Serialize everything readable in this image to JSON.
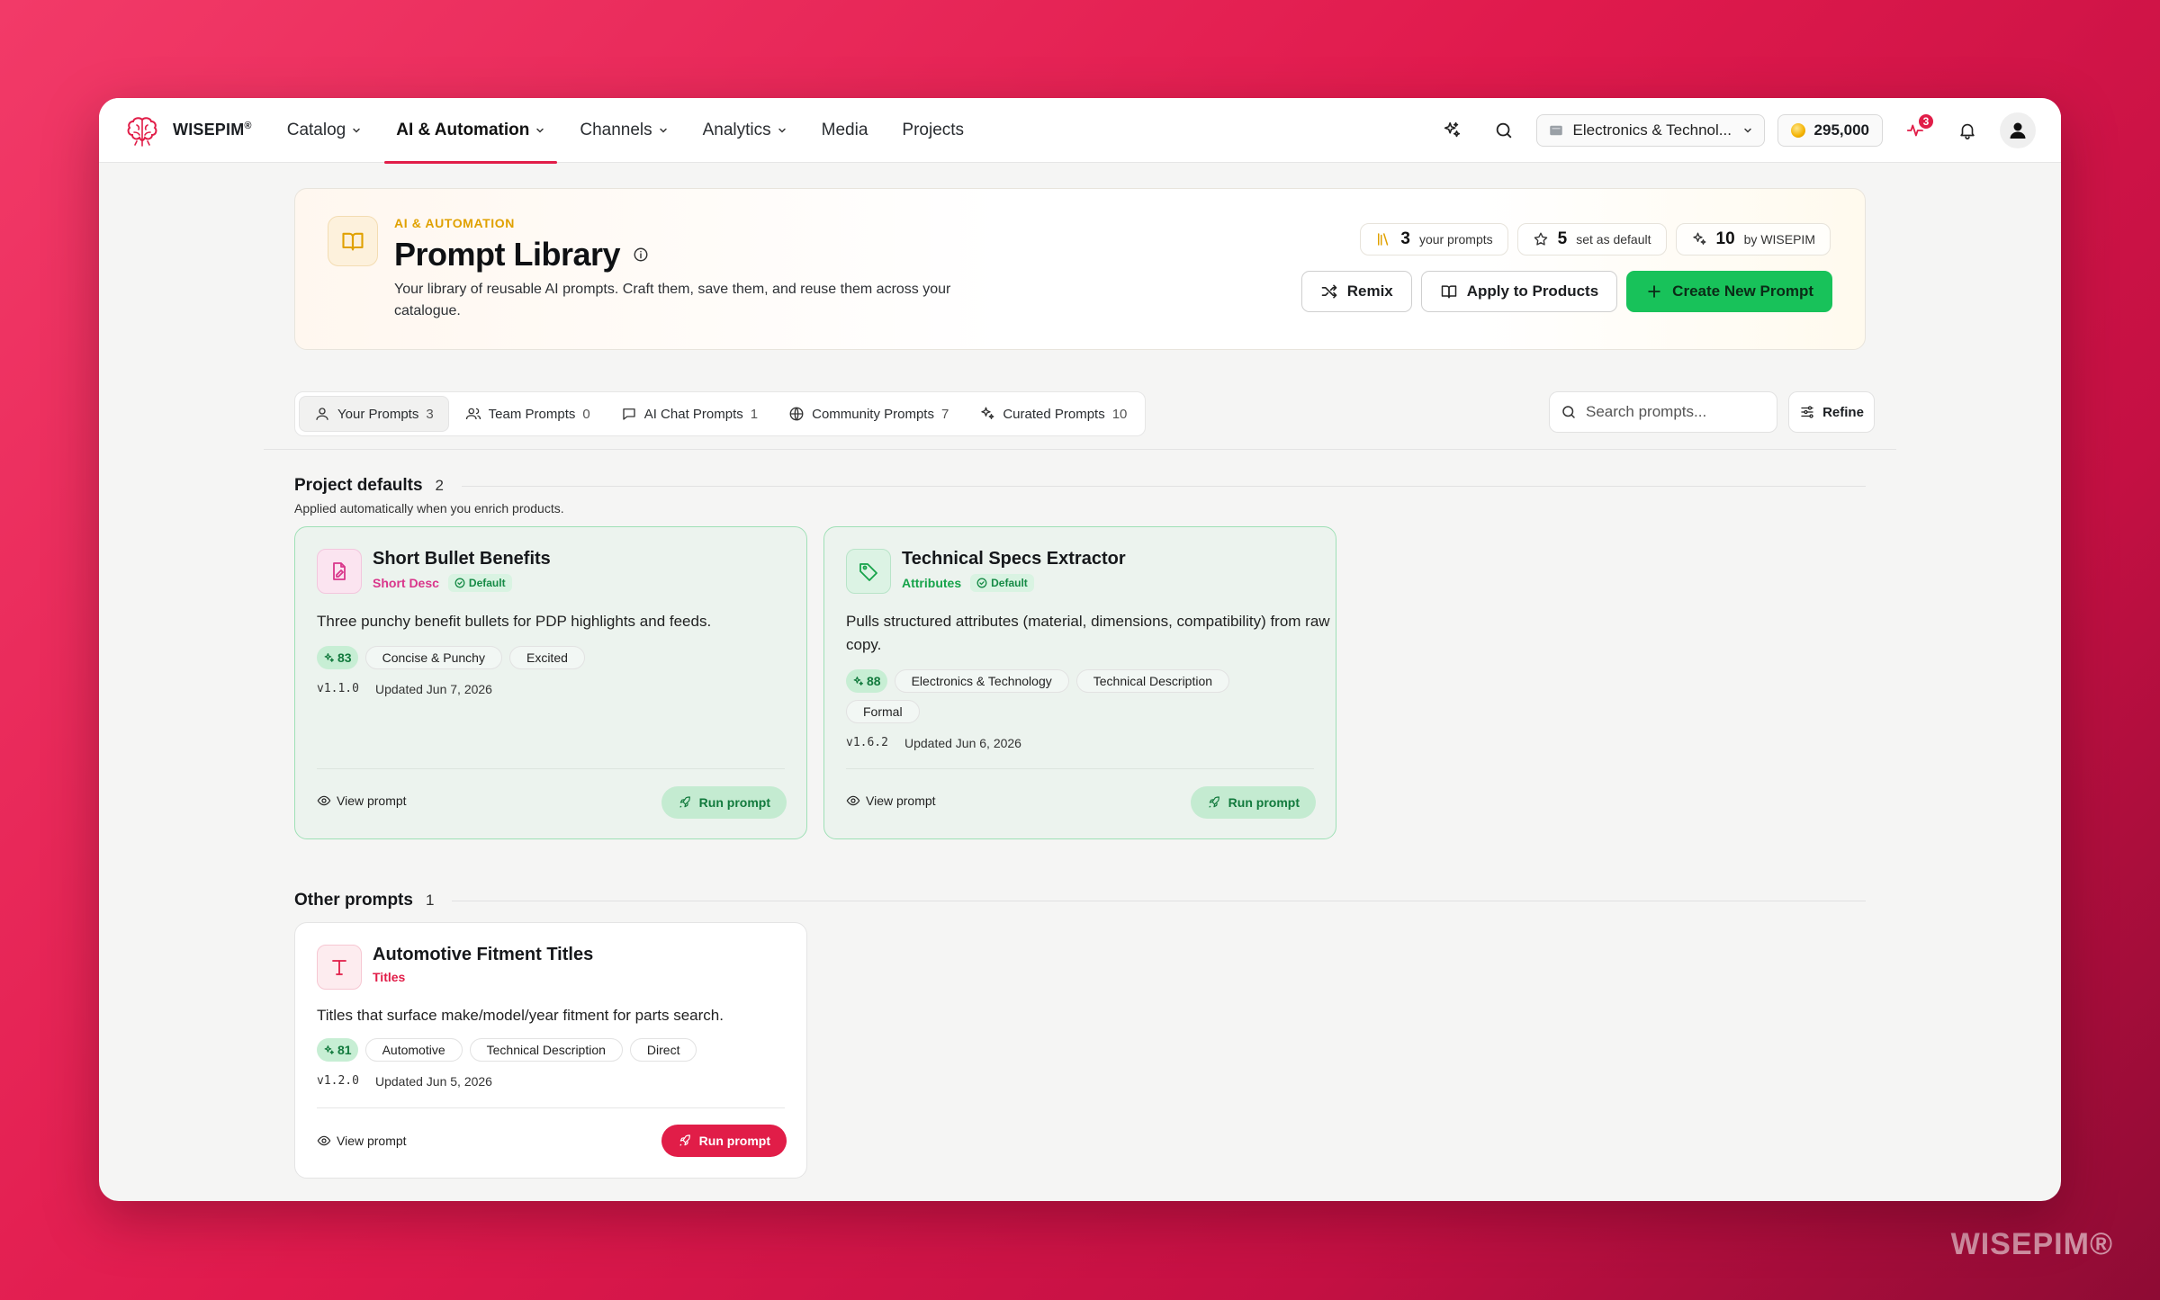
{
  "brand": {
    "name": "WISEPIM",
    "watermark": "WISEPIM®"
  },
  "nav": {
    "items": [
      {
        "label": "Catalog",
        "has_menu": true,
        "active": false
      },
      {
        "label": "AI & Automation",
        "has_menu": true,
        "active": true
      },
      {
        "label": "Channels",
        "has_menu": true,
        "active": false
      },
      {
        "label": "Analytics",
        "has_menu": true,
        "active": false
      },
      {
        "label": "Media",
        "has_menu": false,
        "active": false
      },
      {
        "label": "Projects",
        "has_menu": false,
        "active": false
      }
    ],
    "store_selector": "Electronics & Technol...",
    "credits": "295,000",
    "activity_badge": "3"
  },
  "hero": {
    "kicker": "AI & AUTOMATION",
    "title": "Prompt Library",
    "description": "Your library of reusable AI prompts. Craft them, save them, and reuse them across your catalogue.",
    "stats": [
      {
        "value": "3",
        "label": "your prompts",
        "icon": "library-icon"
      },
      {
        "value": "5",
        "label": "set as default",
        "icon": "star-icon"
      },
      {
        "value": "10",
        "label": "by WISEPIM",
        "icon": "sparkles-icon"
      }
    ],
    "actions": {
      "remix": "Remix",
      "apply": "Apply to Products",
      "create": "Create New Prompt"
    }
  },
  "tabs": [
    {
      "label": "Your Prompts",
      "count": "3",
      "icon": "user-icon",
      "active": true
    },
    {
      "label": "Team Prompts",
      "count": "0",
      "icon": "users-icon",
      "active": false
    },
    {
      "label": "AI Chat Prompts",
      "count": "1",
      "icon": "chat-icon",
      "active": false
    },
    {
      "label": "Community Prompts",
      "count": "7",
      "icon": "globe-icon",
      "active": false
    },
    {
      "label": "Curated Prompts",
      "count": "10",
      "icon": "sparkles-icon",
      "active": false
    }
  ],
  "search": {
    "placeholder": "Search prompts..."
  },
  "refine_label": "Refine",
  "sections": {
    "defaults": {
      "title": "Project defaults",
      "count": "2",
      "subtitle": "Applied automatically when you enrich products."
    },
    "other": {
      "title": "Other prompts",
      "count": "1"
    }
  },
  "cards": [
    {
      "title": "Short Bullet Benefits",
      "category": "Short Desc",
      "category_color": "#d9368b",
      "default_label": "Default",
      "description": "Three punchy benefit bullets for PDP highlights and feeds.",
      "score": "83",
      "tags": [
        "Concise & Punchy",
        "Excited"
      ],
      "version": "v1.1.0",
      "updated": "Updated Jun 7, 2026",
      "view_label": "View prompt",
      "run_label": "Run prompt",
      "icon": "document-edit-icon"
    },
    {
      "title": "Technical Specs Extractor",
      "category": "Attributes",
      "category_color": "#16a34a",
      "default_label": "Default",
      "description": "Pulls structured attributes (material, dimensions, compatibility) from raw copy.",
      "score": "88",
      "tags": [
        "Electronics & Technology",
        "Technical Description",
        "Formal"
      ],
      "version": "v1.6.2",
      "updated": "Updated Jun 6, 2026",
      "view_label": "View prompt",
      "run_label": "Run prompt",
      "icon": "tag-icon"
    },
    {
      "title": "Automotive Fitment Titles",
      "category": "Titles",
      "category_color": "#e11d48",
      "description": "Titles that surface make/model/year fitment for parts search.",
      "score": "81",
      "tags": [
        "Automotive",
        "Technical Description",
        "Direct"
      ],
      "version": "v1.2.0",
      "updated": "Updated Jun 5, 2026",
      "view_label": "View prompt",
      "run_label": "Run prompt",
      "icon": "type-icon"
    }
  ]
}
